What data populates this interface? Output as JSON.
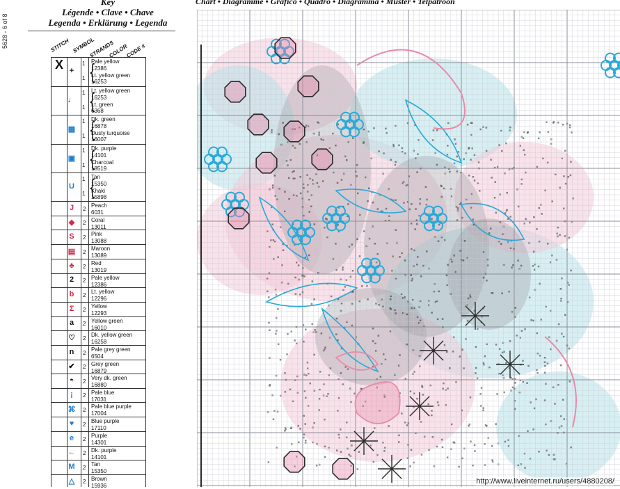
{
  "page_id": "5628 - 6 of 8",
  "key": {
    "title_lines": [
      "Key",
      "Légende • Clave • Chave",
      "Legenda • Erklärung • Legenda"
    ],
    "column_headers": [
      "STITCH",
      "SYMBOL",
      "STRANDS",
      "COLOR",
      "CODE #"
    ]
  },
  "rows": [
    {
      "stitch": "X",
      "symbol": "+",
      "strands": [
        "1",
        "1"
      ],
      "entries": [
        "Pale yellow",
        "12386",
        "Lt. yellow green",
        "16253"
      ]
    },
    {
      "stitch": "",
      "symbol": "♩",
      "strands": [
        "1",
        "1"
      ],
      "entries": [
        "Lt. yellow green",
        "16253",
        "Lt. green",
        "6368"
      ]
    },
    {
      "stitch": "",
      "symbol": "▦",
      "strands": [
        "1",
        "1"
      ],
      "entries": [
        "Dk. green",
        "16878",
        "Dusty turquoise",
        "16007"
      ]
    },
    {
      "stitch": "",
      "symbol": "▣",
      "strands": [
        "1",
        "1"
      ],
      "entries": [
        "Dk. purple",
        "14101",
        "Charcoal",
        "18519"
      ]
    },
    {
      "stitch": "",
      "symbol": "U",
      "strands": [
        "1",
        "1"
      ],
      "entries": [
        "Tan",
        "15350",
        "Khaki",
        "15898"
      ]
    },
    {
      "stitch": "",
      "symbol": "J",
      "strands": [
        "2"
      ],
      "entries": [
        "Peach",
        "6031"
      ]
    },
    {
      "stitch": "",
      "symbol": "◆",
      "strands": [
        "2"
      ],
      "entries": [
        "Coral",
        "13011"
      ]
    },
    {
      "stitch": "",
      "symbol": "S",
      "strands": [
        "2"
      ],
      "entries": [
        "Pink",
        "13088"
      ]
    },
    {
      "stitch": "",
      "symbol": "▤",
      "strands": [
        "2"
      ],
      "entries": [
        "Maroon",
        "13089"
      ]
    },
    {
      "stitch": "",
      "symbol": "♣",
      "strands": [
        "2"
      ],
      "entries": [
        "Red",
        "13019"
      ]
    },
    {
      "stitch": "",
      "symbol": "2",
      "strands": [
        "2"
      ],
      "entries": [
        "Pale yellow",
        "12386"
      ]
    },
    {
      "stitch": "",
      "symbol": "b",
      "strands": [
        "2"
      ],
      "entries": [
        "Lt. yellow",
        "12296"
      ]
    },
    {
      "stitch": "",
      "symbol": "Σ",
      "strands": [
        "2"
      ],
      "entries": [
        "Yellow",
        "12293"
      ]
    },
    {
      "stitch": "",
      "symbol": "a",
      "strands": [
        "2"
      ],
      "entries": [
        "Yellow green",
        "16010"
      ]
    },
    {
      "stitch": "",
      "symbol": "♡",
      "strands": [
        "2"
      ],
      "entries": [
        "Dk. yellow green",
        "16258"
      ]
    },
    {
      "stitch": "",
      "symbol": "n",
      "strands": [
        "2"
      ],
      "entries": [
        "Pale grey green",
        "6504"
      ]
    },
    {
      "stitch": "",
      "symbol": "✔",
      "strands": [
        "2"
      ],
      "entries": [
        "Grey green",
        "16879"
      ]
    },
    {
      "stitch": "",
      "symbol": "◓",
      "strands": [
        "2"
      ],
      "entries": [
        "Very dk. green",
        "16880"
      ]
    },
    {
      "stitch": "",
      "symbol": "¡",
      "strands": [
        "2"
      ],
      "entries": [
        "Pale blue",
        "17031"
      ]
    },
    {
      "stitch": "",
      "symbol": "⌘",
      "strands": [
        "2"
      ],
      "entries": [
        "Pale blue purple",
        "17004"
      ]
    },
    {
      "stitch": "",
      "symbol": "♥",
      "strands": [
        "2"
      ],
      "entries": [
        "Blue purple",
        "17110"
      ]
    },
    {
      "stitch": "",
      "symbol": "e",
      "strands": [
        "2"
      ],
      "entries": [
        "Purple",
        "14301"
      ]
    },
    {
      "stitch": "",
      "symbol": "←",
      "strands": [
        "2"
      ],
      "entries": [
        "Dk. purple",
        "14101"
      ]
    },
    {
      "stitch": "",
      "symbol": "M",
      "strands": [
        "2"
      ],
      "entries": [
        "Tan",
        "15350"
      ]
    },
    {
      "stitch": "",
      "symbol": "△",
      "strands": [
        "2"
      ],
      "entries": [
        "Brown",
        "15936"
      ]
    }
  ],
  "symbol_colors": {
    "pink_group": "#d12a4a",
    "blue_group": "#1f7ecb",
    "black_group": "#111111"
  },
  "chart": {
    "title": "Chart • Diagramme • Gráfico • Quadro • Diagramma • Muster • Telpatroon",
    "colors": {
      "grid": "#c9ccd2",
      "grid_major": "#8a8f98",
      "blue": "#29a9d8",
      "pink": "#e88aaa",
      "teal_light": "#b6e1ea",
      "pink_light": "#f4cbd8",
      "grey": "#9a9aa0",
      "dark": "#2b2b2b"
    }
  },
  "watermark": "http://www.liveinternet.ru/users/4880208/"
}
